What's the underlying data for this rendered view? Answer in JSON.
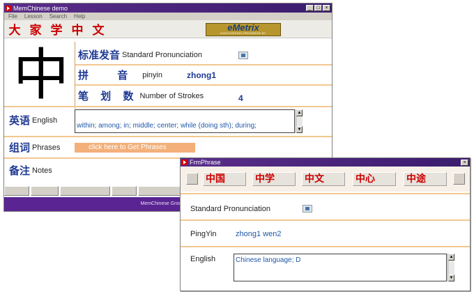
{
  "main_window": {
    "title": "MemChinese demo",
    "menu": [
      "File",
      "Lesson",
      "Search",
      "Help"
    ],
    "toolbar_chars": [
      "大",
      "家",
      "学",
      "中",
      "文"
    ],
    "logo": {
      "name": "eMetrix",
      "tagline": "DISCOVERING PROGRESS BY"
    },
    "character": "中",
    "pronunciation": {
      "hanzi": "标准发音",
      "label": "Standard Pronunciation"
    },
    "pinyin": {
      "hanzi": "拼 音",
      "label": "pinyin",
      "value": "zhong1"
    },
    "strokes": {
      "hanzi": "笔 划 数",
      "label": "Number of Strokes",
      "value": "4"
    },
    "english": {
      "hanzi": "英语",
      "label": "English",
      "text": "within; among; in; middle; center; while (doing sth); during;"
    },
    "phrases": {
      "hanzi": "组词",
      "label": "Phrases",
      "button": "click here to Get Phrases"
    },
    "notes": {
      "hanzi": "备注",
      "label": "Notes"
    },
    "footer": "MemChinese Group All R"
  },
  "popup": {
    "title": "FrmPhrase",
    "phrases": [
      "中国",
      "中学",
      "中文",
      "中心",
      "中途"
    ],
    "pronunciation_label": "Standard Pronunciation",
    "pingyin_label": "PingYin",
    "pingyin_value": "zhong1 wen2",
    "english_label": "English",
    "english_value": "Chinese language; D"
  },
  "colors": {
    "title_purple": "#5a2e8a",
    "hanzi_red": "#cc0000",
    "hanzi_blue": "#1f3a93",
    "separator": "#f2c78f",
    "logo_gold": "#b8962e"
  },
  "icons": [
    "app-icon",
    "speaker-icon",
    "minimize-icon",
    "maximize-icon",
    "close-icon"
  ]
}
